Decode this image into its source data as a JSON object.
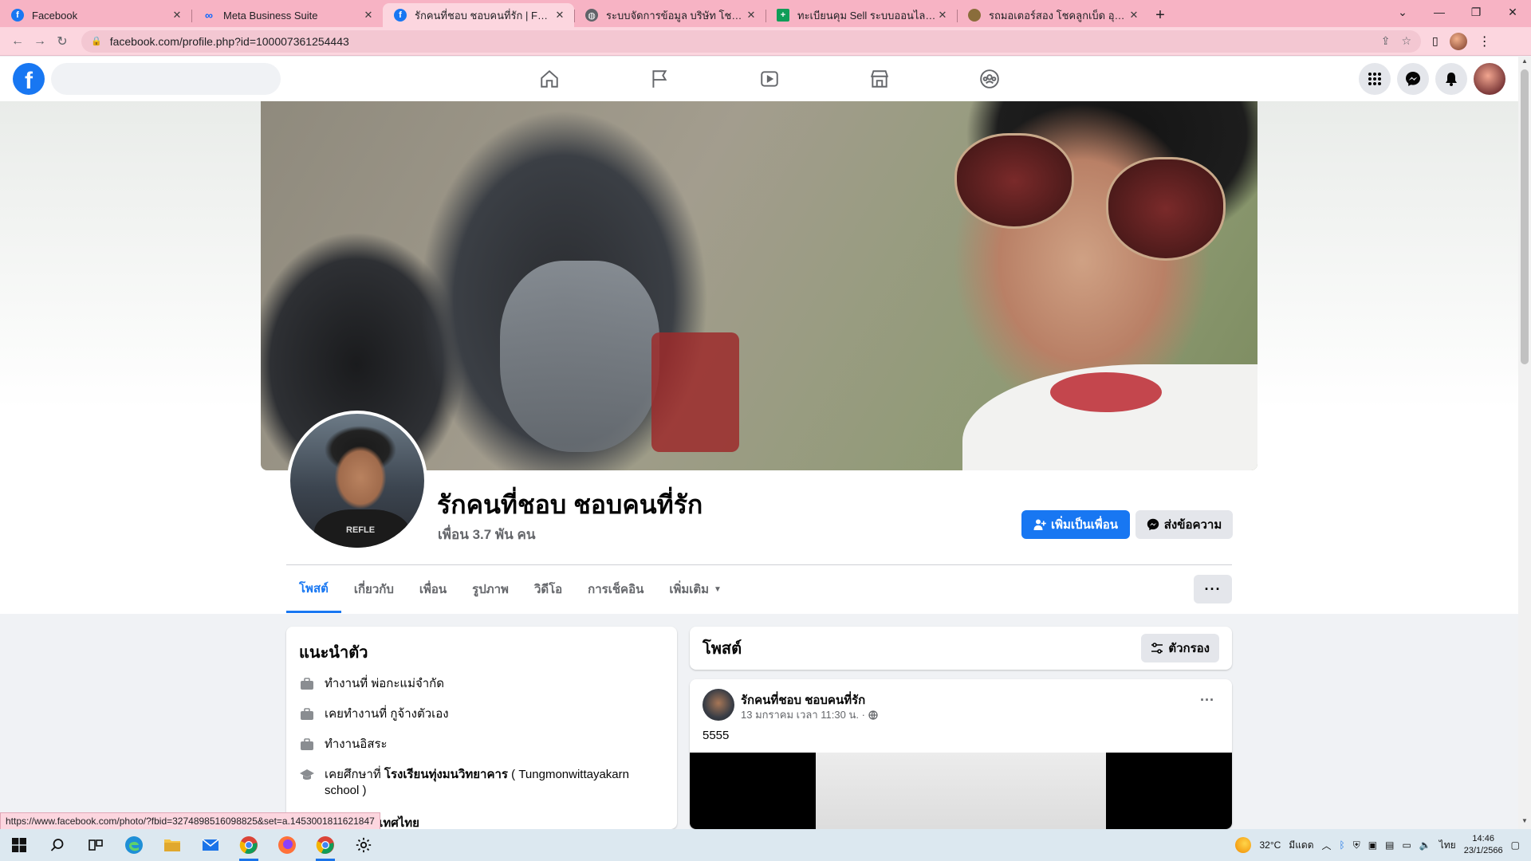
{
  "browser": {
    "tabs": [
      {
        "title": "Facebook",
        "icon": "facebook-icon",
        "active": false
      },
      {
        "title": "Meta Business Suite",
        "icon": "meta-icon",
        "active": false
      },
      {
        "title": "รักคนที่ชอบ ชอบคนที่รัก | Facebook",
        "icon": "facebook-icon",
        "active": true
      },
      {
        "title": "ระบบจัดการข้อมูล บริษัท โชคลูกเบ็ด ร",
        "icon": "globe-icon",
        "active": false
      },
      {
        "title": "ทะเบียนคุม Sell ระบบออนไลน์.xlsx - G",
        "icon": "sheets-icon",
        "active": false
      },
      {
        "title": "รถมอเตอร์สอง โชคลูกเบ็ด อุดรธานี",
        "icon": "site-icon",
        "active": false
      }
    ],
    "url": "facebook.com/profile.php?id=100007361254443",
    "status_url": "https://www.facebook.com/photo/?fbid=3274898516098825&set=a.1453001811621847"
  },
  "profile": {
    "name": "รักคนที่ชอบ ชอบคนที่รัก",
    "friends": "เพื่อน 3.7 พัน คน",
    "add_friend_label": "เพิ่มเป็นเพื่อน",
    "message_label": "ส่งข้อความ",
    "tabs": [
      "โพสต์",
      "เกี่ยวกับ",
      "เพื่อน",
      "รูปภาพ",
      "วิดีโอ",
      "การเช็คอิน",
      "เพิ่มเติม"
    ],
    "active_tab": "โพสต์"
  },
  "intro": {
    "title": "แนะนำตัว",
    "rows": [
      {
        "icon": "briefcase-icon",
        "prefix": "ทำงานที่ ",
        "bold": "",
        "text": "พ่อกะแม่จำกัด"
      },
      {
        "icon": "briefcase-icon",
        "prefix": "เคยทำงานที่ ",
        "bold": "",
        "text": "กูจ้างตัวเอง"
      },
      {
        "icon": "briefcase-icon",
        "prefix": "",
        "bold": "",
        "text": "ทำงานอิสระ"
      },
      {
        "icon": "graduation-cap-icon",
        "prefix": "เคยศึกษาที่ ",
        "bold": "โรงเรียนทุ่งมนวิทยาคาร",
        "text": " ( Tungmonwittayakarn school )"
      }
    ],
    "partial_row": "สุรินทร์ ประเทศไทย"
  },
  "posts": {
    "title": "โพสต์",
    "filter_label": "ตัวกรอง",
    "items": [
      {
        "author": "รักคนที่ชอบ ชอบคนที่รัก",
        "time": "13 มกราคม เวลา 11:30 น. ·",
        "text": "5555"
      }
    ]
  },
  "taskbar": {
    "weather": "32°C",
    "weather_label": "มีแดด",
    "lang": "ไทย",
    "time": "14:46",
    "date": "23/1/2566"
  },
  "colors": {
    "fb_blue": "#1877f2",
    "chrome_theme": "#f7b3c4"
  }
}
